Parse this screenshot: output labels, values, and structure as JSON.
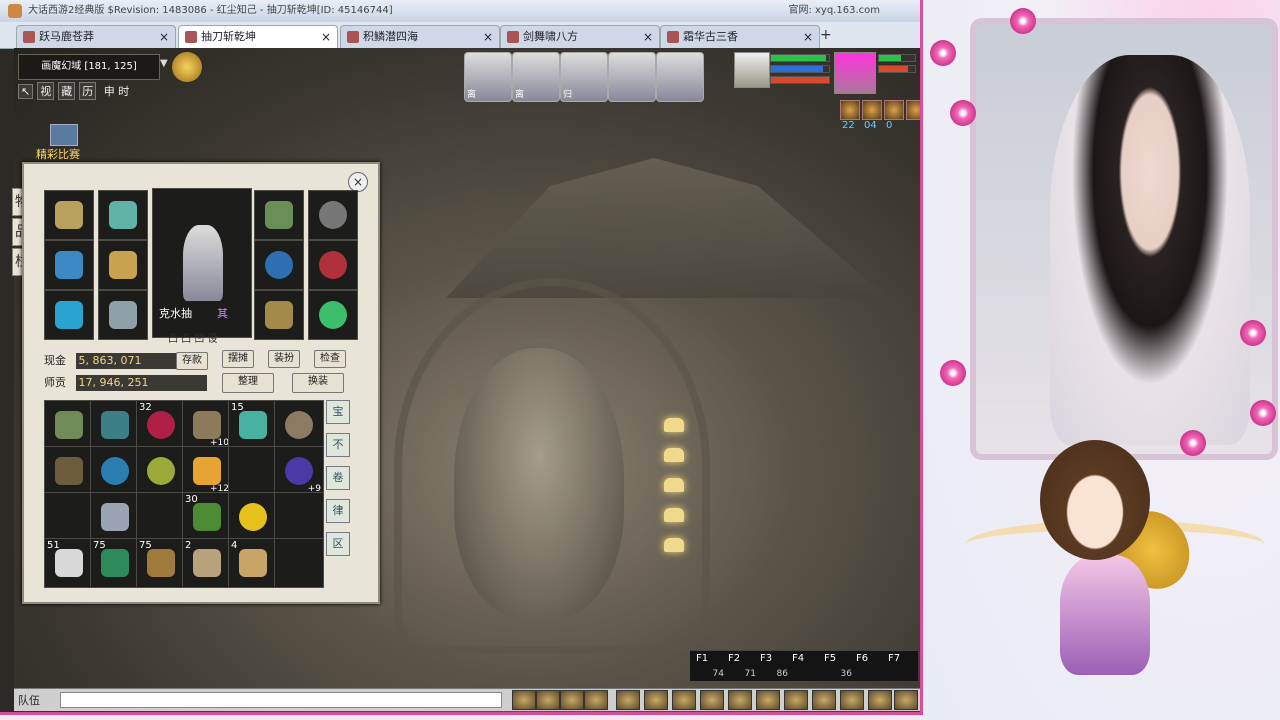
{
  "window": {
    "title": "大话西游2经典版 $Revision: 1483086 - 红尘知己 - 抽刀斩乾坤[ID: 45146744]",
    "right_info": "官网: xyq.163.com"
  },
  "tabs": [
    {
      "label": "跃马鹿苍莽"
    },
    {
      "label": "抽刀斩乾坤"
    },
    {
      "label": "积鳞潜四海"
    },
    {
      "label": "剑舞啸八方"
    },
    {
      "label": "霜华古三香"
    }
  ],
  "tab_new": "+",
  "hud": {
    "location": "画魔幻域 [181, 125]",
    "menu_buttons": [
      "↖",
      "视",
      "藏",
      "历"
    ],
    "time": "申 时",
    "event_label": "精彩比赛"
  },
  "team_portraits": [
    {
      "tag": "离"
    },
    {
      "tag": "离"
    },
    {
      "tag": "归"
    },
    {
      "tag": ""
    },
    {
      "tag": ""
    }
  ],
  "status": {
    "hp_pct": 0.95,
    "mp_pct": 0.9,
    "hp_color": "#2cc14a",
    "mp_color": "#2b6fd8",
    "sp_color": "#d84a2b"
  },
  "buff_numbers": [
    "22",
    "04",
    "0"
  ],
  "inventory": {
    "side_tabs": [
      "物",
      "品",
      "栏"
    ],
    "character_name": "克水抽",
    "character_tag": "其",
    "character_icons": "凸 凸 凹 设",
    "money_label": "现金",
    "money_value": "5, 863, 071",
    "tuition_label": "师贡",
    "tuition_value": "17, 946, 251",
    "buttons": {
      "deposit": "存款",
      "connect": "摆摊",
      "equip": "装扮",
      "inspect": "检查",
      "organize": "整理",
      "swap": "换装"
    },
    "slot_labels": {
      "s1": "",
      "s2": "",
      "s3": "32",
      "s4": "",
      "s5": "15",
      "s6": "",
      "s7": "+10",
      "s8": "+12",
      "s9": "+9",
      "s10": "30",
      "s11": "51",
      "s12": "75",
      "s13": "75",
      "s14": "2",
      "s15": "4"
    },
    "scroll_tabs": [
      "宝",
      "不",
      "卷",
      "律",
      "区",
      "◇"
    ]
  },
  "hotkeys": [
    {
      "key": "F1",
      "count": "74"
    },
    {
      "key": "F2",
      "count": "71"
    },
    {
      "key": "F3",
      "count": "86"
    },
    {
      "key": "F4",
      "count": ""
    },
    {
      "key": "F5",
      "count": "36"
    },
    {
      "key": "F6",
      "count": ""
    },
    {
      "key": "F7",
      "count": ""
    }
  ],
  "chat": {
    "channel_label": "队伍"
  },
  "colors": {
    "accent_pink": "#d84d9a",
    "gold_text": "#f5d58a"
  }
}
